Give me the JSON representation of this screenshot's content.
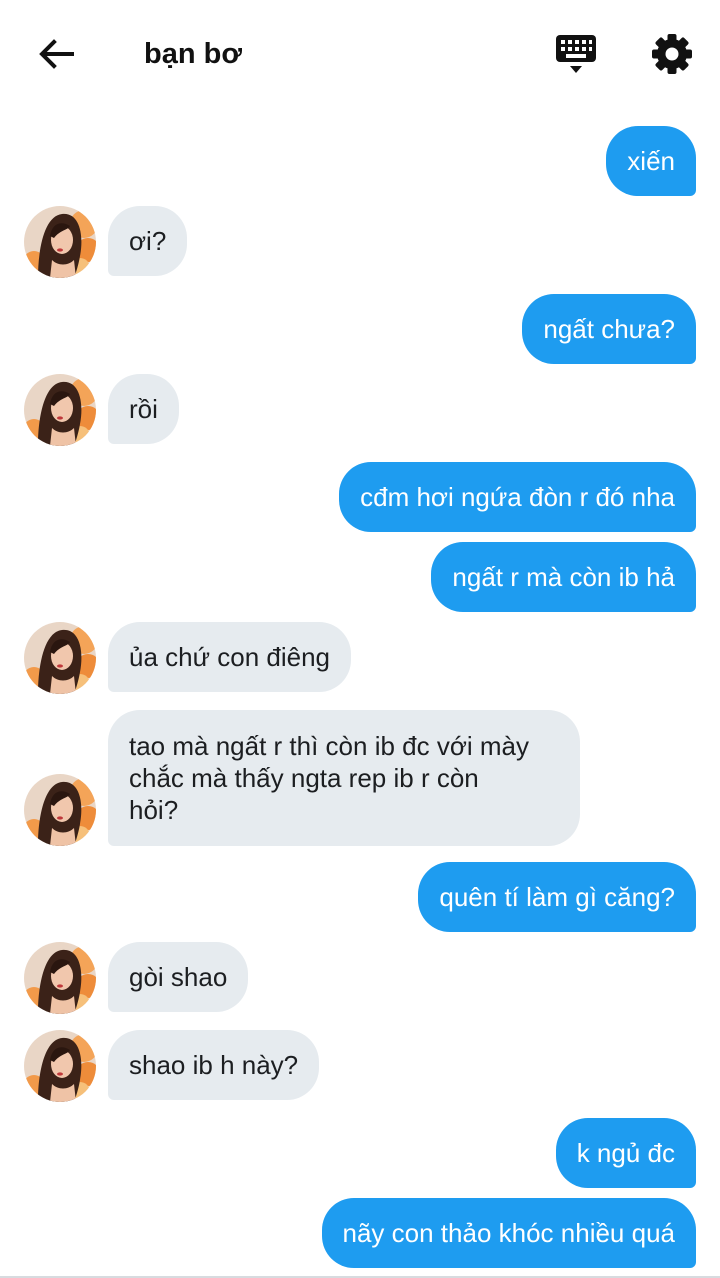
{
  "header": {
    "title": "bạn bơ",
    "back_icon": "arrow-left-icon",
    "keyboard_icon": "keyboard-icon",
    "settings_icon": "gear-icon"
  },
  "colors": {
    "outgoing_bubble": "#1e9cf0",
    "incoming_bubble": "#e6ebef"
  },
  "messages": [
    {
      "sender": "me",
      "text": "xiến"
    },
    {
      "sender": "them",
      "text": "ơi?"
    },
    {
      "sender": "me",
      "text": "ngất chưa?"
    },
    {
      "sender": "them",
      "text": "rồi"
    },
    {
      "sender": "me",
      "text": "cđm hơi ngứa đòn r đó nha"
    },
    {
      "sender": "me",
      "text": "ngất r mà còn ib hả"
    },
    {
      "sender": "them",
      "text": "ủa chứ con điêng"
    },
    {
      "sender": "them",
      "text": "tao mà ngất r thì còn ib đc với mày\nchắc mà thấy ngta rep ib r còn\nhỏi?"
    },
    {
      "sender": "me",
      "text": "quên tí làm gì căng?"
    },
    {
      "sender": "them",
      "text": "gòi shao"
    },
    {
      "sender": "them",
      "text": "shao ib h này?"
    },
    {
      "sender": "me",
      "text": "k ngủ đc"
    },
    {
      "sender": "me",
      "text": "nãy con thảo khóc nhiều quá"
    }
  ]
}
